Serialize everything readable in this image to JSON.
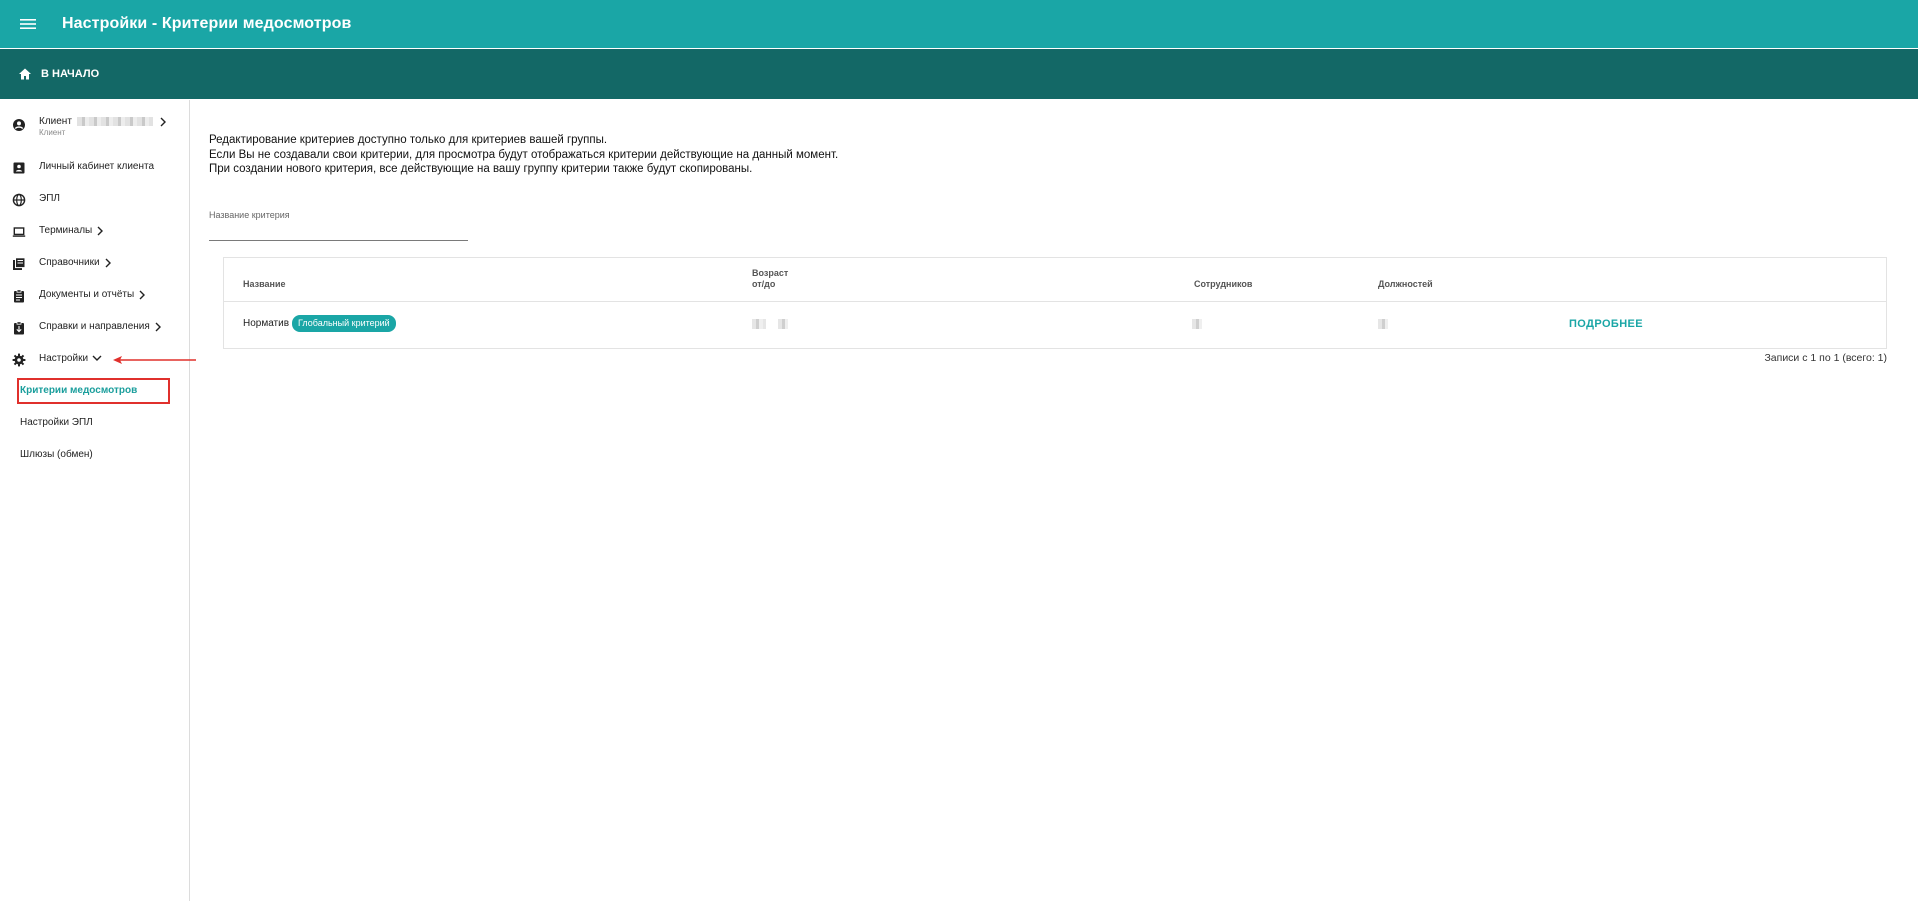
{
  "appbar": {
    "title": "Настройки - Критерии медосмотров",
    "menu_icon": "menu-icon"
  },
  "subbar": {
    "home_label": "В НАЧАЛО",
    "home_icon": "home-icon"
  },
  "sidebar": {
    "client": {
      "label": "Клиент",
      "subtitle": "Клиент"
    },
    "items": [
      {
        "label": "Личный кабинет клиента",
        "icon": "contact-card-icon"
      },
      {
        "label": "ЭПЛ",
        "icon": "globe-icon"
      },
      {
        "label": "Терминалы",
        "icon": "laptop-icon"
      },
      {
        "label": "Справочники",
        "icon": "library-icon"
      },
      {
        "label": "Документы и отчёты",
        "icon": "clipboard-icon"
      },
      {
        "label": "Справки и направления",
        "icon": "assignment-icon"
      },
      {
        "label": "Настройки",
        "icon": "gear-icon"
      }
    ],
    "subitems": [
      {
        "label": "Критерии медосмотров"
      },
      {
        "label": "Настройки ЭПЛ"
      },
      {
        "label": "Шлюзы (обмен)"
      }
    ]
  },
  "main": {
    "info_lines": [
      "Редактирование критериев доступно только для критериев вашей группы.",
      "Если Вы не создавали свои критерии, для просмотра будут отображаться критерии действующие на данный момент.",
      "При создании нового критерия, все действующие на вашу группу критерии также будут скопированы."
    ],
    "filter_label": "Название критерия",
    "filter_value": "",
    "table": {
      "headers": {
        "name": "Название",
        "age_line1": "Возраст",
        "age_line2": "от/до",
        "employees": "Сотрудников",
        "positions": "Должностей"
      },
      "rows": [
        {
          "name": "Норматив",
          "badge": "Глобальный критерий",
          "action": "ПОДРОБНЕЕ"
        }
      ]
    },
    "pager": "Записи с 1 по 1 (всего: 1)"
  },
  "colors": {
    "appbar": "#1aa6a6",
    "subbar": "#136866",
    "accent": "#1aa6a6",
    "highlight": "#e0302c"
  }
}
